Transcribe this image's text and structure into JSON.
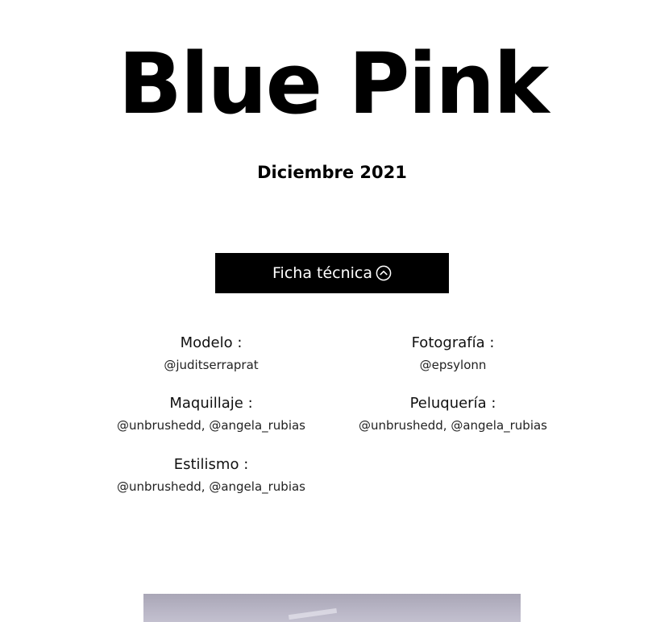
{
  "header": {
    "title": "Blue Pink",
    "date": "Diciembre 2021"
  },
  "ficha": {
    "button_label": "Ficha técnica",
    "button_icon": "chevron-up-circle-icon"
  },
  "credits": [
    {
      "role": "Modelo :",
      "handle": "@juditserraprat"
    },
    {
      "role": "Fotografía :",
      "handle": "@epsylonn"
    },
    {
      "role": "Maquillaje :",
      "handle": "@unbrushedd, @angela_rubias"
    },
    {
      "role": "Peluquería :",
      "handle": "@unbrushedd, @angela_rubias"
    },
    {
      "role": "Estilismo :",
      "handle": "@unbrushedd, @angela_rubias"
    }
  ],
  "colors": {
    "button_bg": "#000000",
    "button_text": "#ffffff",
    "text": "#000000",
    "photo_tint": "#b9b6c6"
  }
}
